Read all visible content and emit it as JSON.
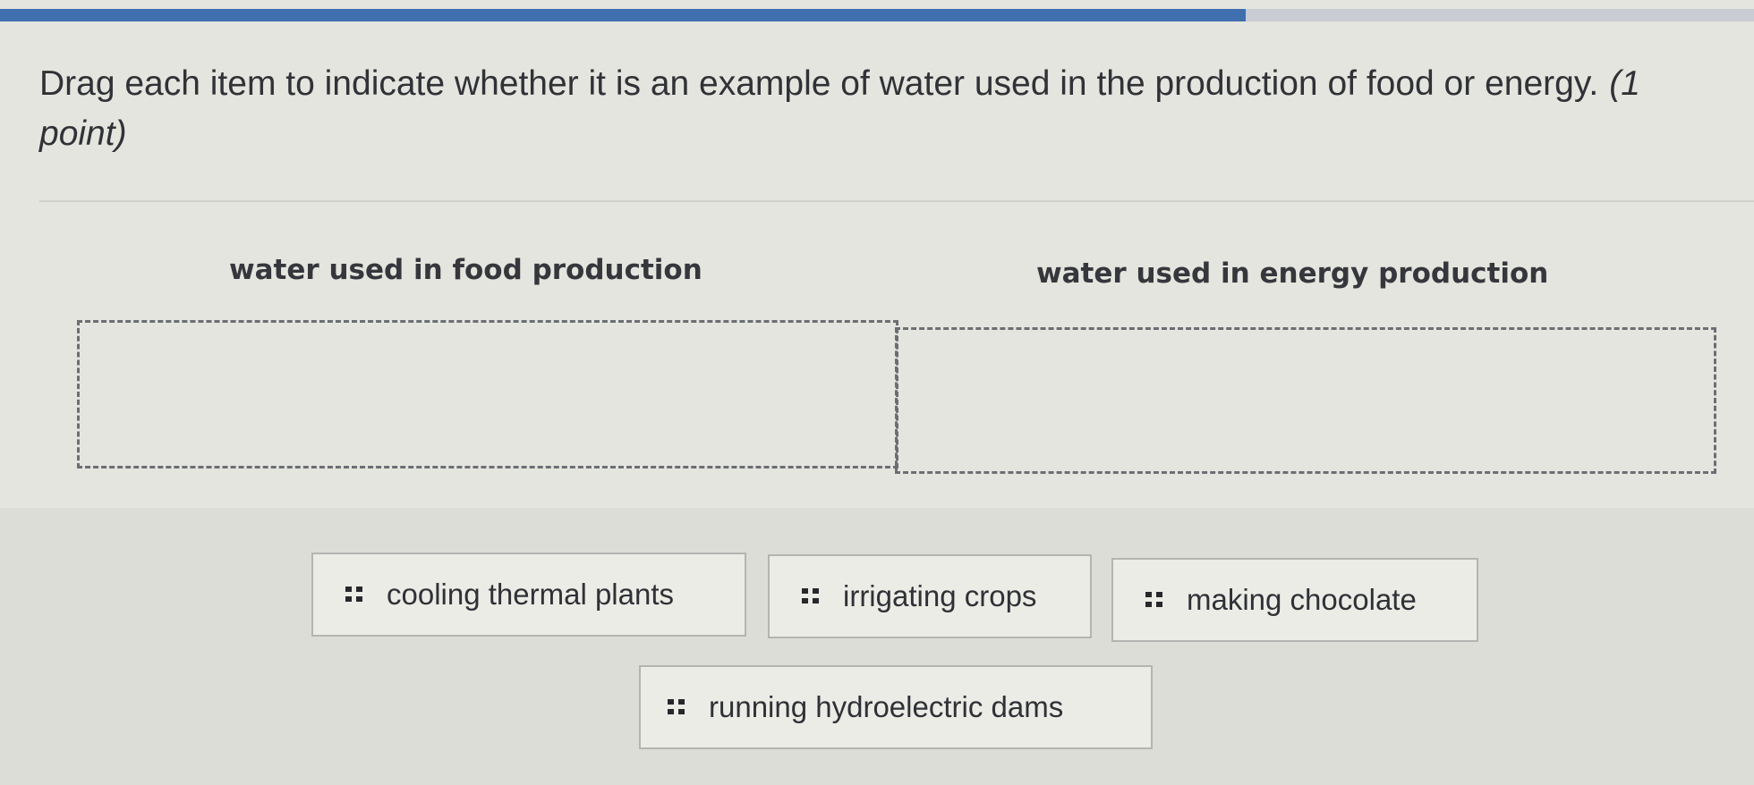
{
  "progress": {
    "fraction": 0.71
  },
  "question": {
    "text": "Drag each item to indicate whether it is an example of water used in the production of food or energy.",
    "points": "(1 point)"
  },
  "categories": [
    {
      "label": "water used in food production"
    },
    {
      "label": "water used in energy production"
    }
  ],
  "items": [
    {
      "label": "cooling thermal plants",
      "icon": "drag-handle-icon"
    },
    {
      "label": "irrigating crops",
      "icon": "drag-handle-icon"
    },
    {
      "label": "making chocolate",
      "icon": "drag-handle-icon"
    },
    {
      "label": "running hydroelectric dams",
      "icon": "drag-handle-icon"
    }
  ],
  "colors": {
    "progress_fill": "#3f6fae",
    "progress_track": "#c9ccd2",
    "background": "#e4e5de"
  }
}
